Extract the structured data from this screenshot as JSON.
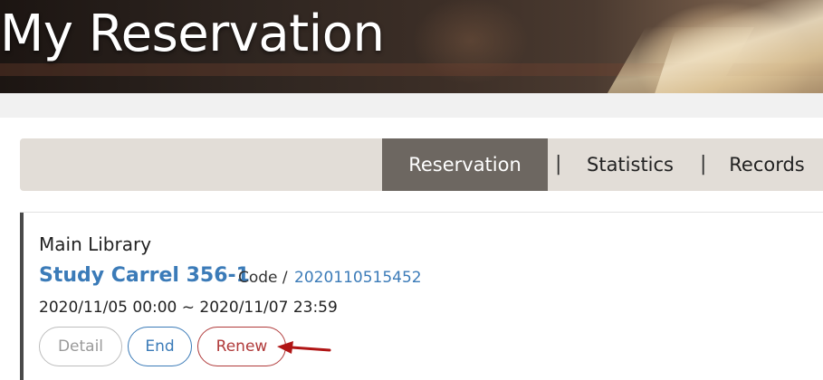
{
  "banner": {
    "title": "My Reservation"
  },
  "tabs": [
    {
      "label": "Reservation",
      "active": true
    },
    {
      "label": "Statistics",
      "active": false
    },
    {
      "label": "Records",
      "active": false
    }
  ],
  "tab_separator": "|",
  "reservation": {
    "library": "Main Library",
    "seat": "Study Carrel 356-1",
    "code_label": "Code /",
    "code_value": "2020110515452",
    "time_range": "2020/11/05 00:00 ~ 2020/11/07 23:59",
    "buttons": {
      "detail": "Detail",
      "end": "End",
      "renew": "Renew"
    }
  },
  "colors": {
    "link_blue": "#3b7bb8",
    "renew_red": "#b03a3a",
    "active_tab": "#6d6761",
    "tab_bar": "#e2ddd7",
    "arrow": "#b01515"
  }
}
